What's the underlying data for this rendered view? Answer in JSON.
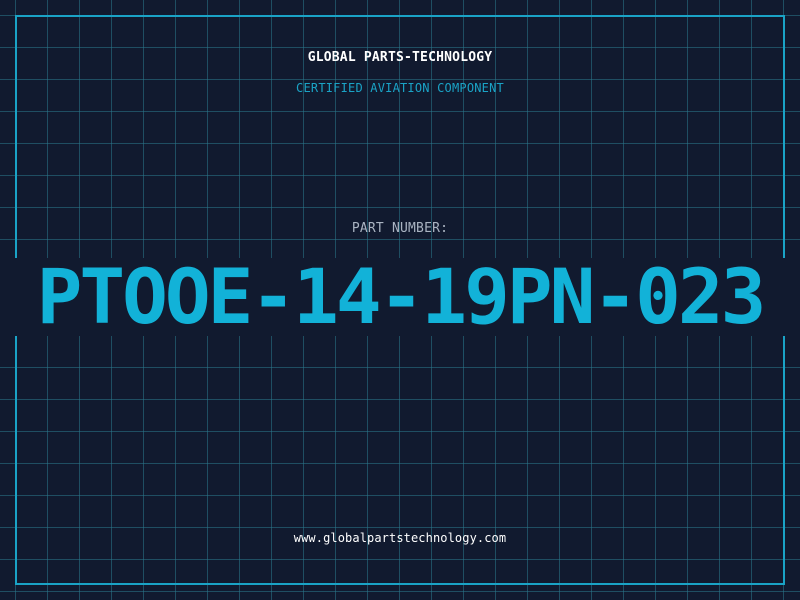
{
  "header": {
    "company": "GLOBAL PARTS-TECHNOLOGY",
    "subtitle": "CERTIFIED AVIATION COMPONENT"
  },
  "part": {
    "label": "PART NUMBER:",
    "number": "PTOOE-14-19PN-023"
  },
  "footer": {
    "url": "www.globalpartstechnology.com"
  },
  "colors": {
    "background": "#111a2f",
    "accent": "#1aa3c6",
    "part_number": "#12b2d8",
    "grid": "#2a788c"
  }
}
